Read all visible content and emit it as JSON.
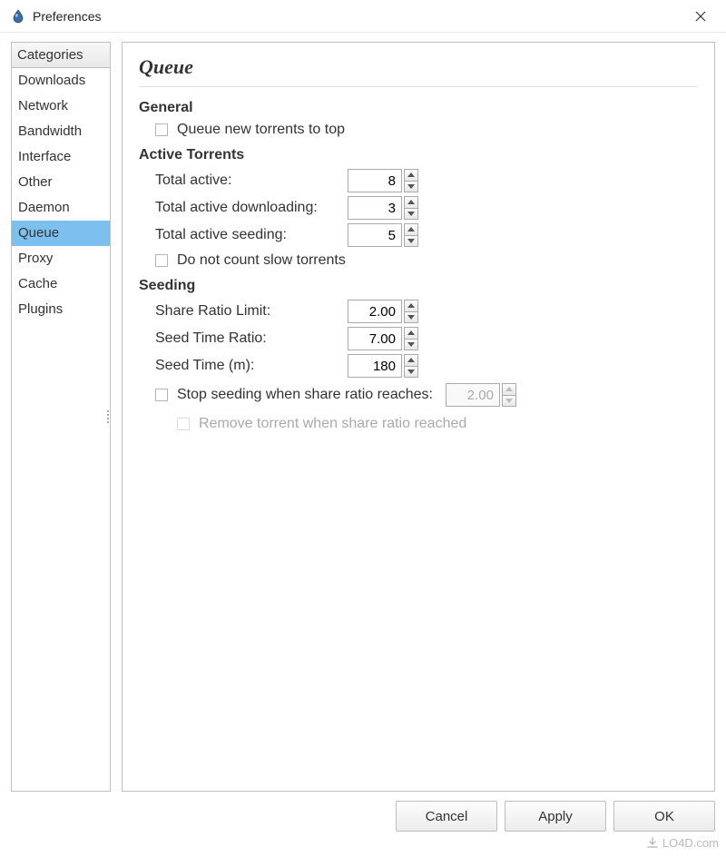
{
  "window": {
    "title": "Preferences"
  },
  "sidebar": {
    "header": "Categories",
    "items": [
      {
        "label": "Downloads",
        "selected": false
      },
      {
        "label": "Network",
        "selected": false
      },
      {
        "label": "Bandwidth",
        "selected": false
      },
      {
        "label": "Interface",
        "selected": false
      },
      {
        "label": "Other",
        "selected": false
      },
      {
        "label": "Daemon",
        "selected": false
      },
      {
        "label": "Queue",
        "selected": true
      },
      {
        "label": "Proxy",
        "selected": false
      },
      {
        "label": "Cache",
        "selected": false
      },
      {
        "label": "Plugins",
        "selected": false
      }
    ]
  },
  "page": {
    "title": "Queue",
    "sections": {
      "general": {
        "header": "General",
        "queue_new_to_top": {
          "label": "Queue new torrents to top",
          "checked": false
        }
      },
      "active": {
        "header": "Active Torrents",
        "total_active": {
          "label": "Total active:",
          "value": "8"
        },
        "total_downloading": {
          "label": "Total active downloading:",
          "value": "3"
        },
        "total_seeding": {
          "label": "Total active seeding:",
          "value": "5"
        },
        "no_count_slow": {
          "label": "Do not count slow torrents",
          "checked": false
        }
      },
      "seeding": {
        "header": "Seeding",
        "share_ratio_limit": {
          "label": "Share Ratio Limit:",
          "value": "2.00"
        },
        "seed_time_ratio": {
          "label": "Seed Time Ratio:",
          "value": "7.00"
        },
        "seed_time_m": {
          "label": "Seed Time (m):",
          "value": "180"
        },
        "stop_seeding": {
          "label": "Stop seeding when share ratio reaches:",
          "checked": false,
          "value": "2.00"
        },
        "remove_torrent": {
          "label": "Remove torrent when share ratio reached",
          "checked": false
        }
      }
    }
  },
  "footer": {
    "cancel": "Cancel",
    "apply": "Apply",
    "ok": "OK"
  },
  "watermark": "LO4D.com"
}
